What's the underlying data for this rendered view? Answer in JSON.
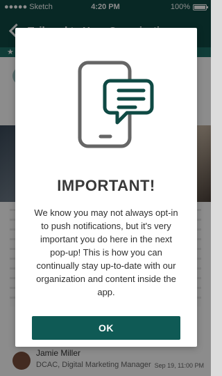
{
  "status_bar": {
    "carrier": "●●●●● Sketch",
    "time": "4:20 PM",
    "battery": "100%"
  },
  "nav": {
    "title": "Tailored to Your Organization"
  },
  "background_card": {
    "author": "Jamie Miller",
    "role": "DCAC, Digital Marketing Manager",
    "date": "Sep 19, 11:00 PM"
  },
  "modal": {
    "title": "IMPORTANT!",
    "body": "We know you may not always opt-in to push notifications, but it's very important you do here in the next pop-up! This is how you can continually stay up-to-date with our organization and content inside the app.",
    "ok_label": "OK",
    "icon": "phone-message-icon",
    "colors": {
      "primary": "#0f5a55",
      "icon_outline": "#666666",
      "bubble_outline": "#0f4a44"
    }
  }
}
